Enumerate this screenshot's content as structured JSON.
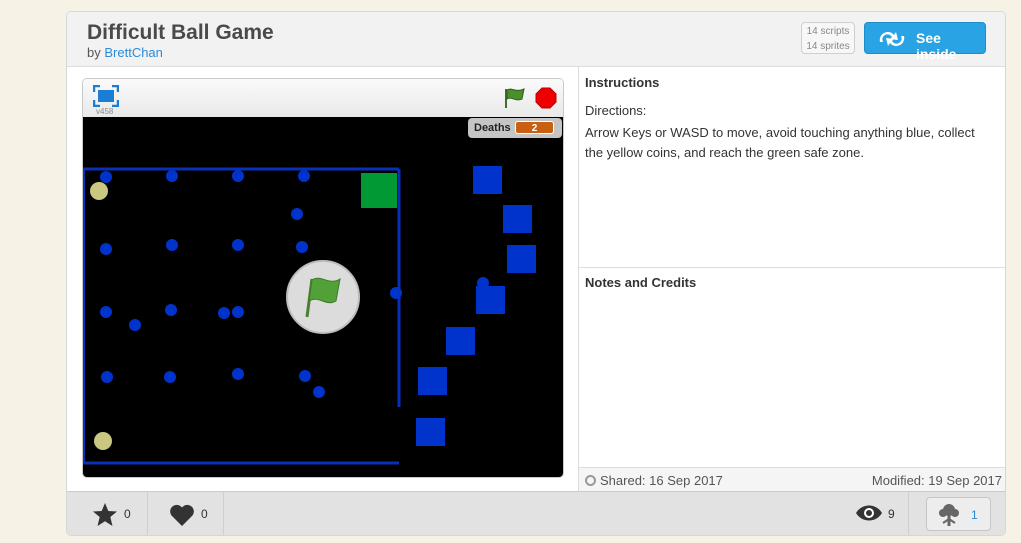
{
  "project": {
    "title": "Difficult Ball Game",
    "by_prefix": "by",
    "author": "BrettChan"
  },
  "counts": {
    "scripts": "14 scripts",
    "sprites": "14 sprites"
  },
  "see_inside": {
    "label": "See inside",
    "icon": "remix-arrows-icon"
  },
  "player": {
    "version": "v458",
    "icons": [
      "fullscreen-icon",
      "green-flag-icon",
      "stop-icon",
      "big-green-flag-icon"
    ],
    "monitor": {
      "label": "Deaths",
      "value": "2"
    },
    "colors": {
      "stage": "#000000",
      "obstacle": "#0033cc",
      "coin": "#c9c780",
      "safe_zone": "#009933",
      "monitor_value": "#c85f12"
    }
  },
  "instructions": {
    "heading": "Instructions",
    "label": "Directions:",
    "text": "Arrow Keys or WASD to move, avoid touching anything blue, collect the yellow coins, and reach the green safe zone."
  },
  "notes": {
    "heading": "Notes and Credits"
  },
  "meta": {
    "shared": "Shared: 16 Sep 2017",
    "modified": "Modified: 19 Sep 2017"
  },
  "stats": {
    "favorites": "0",
    "loves": "0",
    "views": "9",
    "remixes": "1",
    "icons": [
      "star-icon",
      "heart-icon",
      "eye-icon",
      "remix-tree-icon"
    ]
  }
}
